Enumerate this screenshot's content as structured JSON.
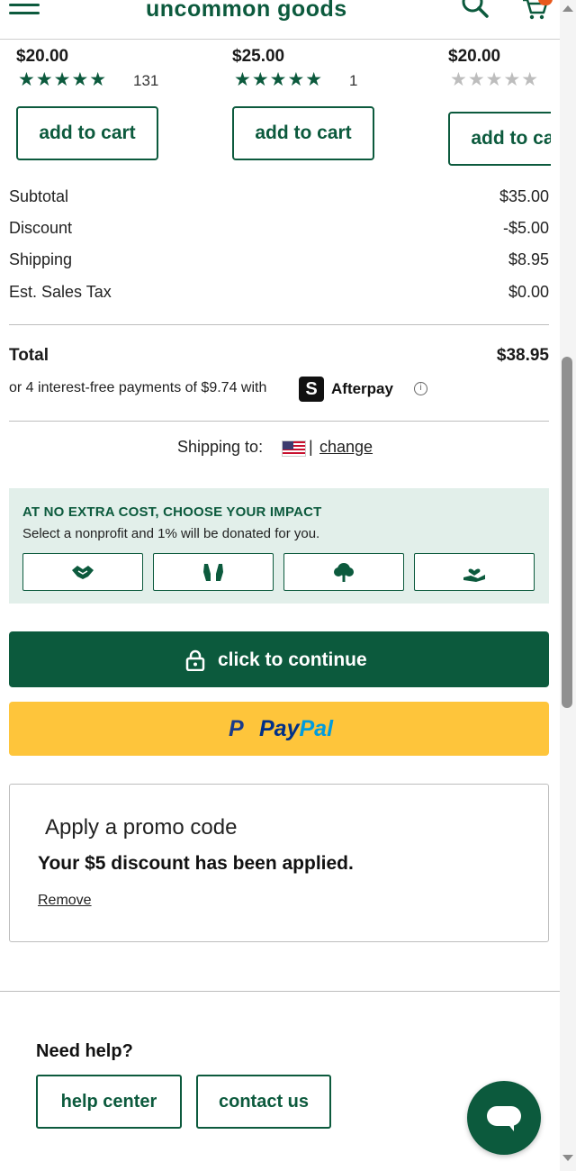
{
  "header": {
    "logo_text": "uncommon goods",
    "menu_icon": "hamburger-menu-icon",
    "search_icon": "search-icon",
    "cart_icon": "cart-icon"
  },
  "products": [
    {
      "price": "$20.00",
      "rating": 5,
      "review_count": "131",
      "button_label": "add to cart"
    },
    {
      "price": "$25.00",
      "rating": 5,
      "review_count": "1",
      "button_label": "add to cart"
    },
    {
      "price": "$20.00",
      "rating": 0,
      "review_count": "",
      "button_label": "add to cart"
    }
  ],
  "summary": {
    "subtotal_label": "Subtotal",
    "subtotal_value": "$35.00",
    "discount_label": "Discount",
    "discount_value": "-$5.00",
    "shipping_label": "Shipping",
    "shipping_value": "$8.95",
    "tax_label": "Est. Sales Tax",
    "tax_value": "$0.00",
    "total_label": "Total",
    "total_value": "$38.95"
  },
  "afterpay": {
    "text": "or 4 interest-free payments of $9.74 with",
    "logo_glyph": "S",
    "brand": "Afterpay",
    "info_glyph": "i"
  },
  "shipping_to": {
    "label": "Shipping to:",
    "separator": "|",
    "change_label": "change"
  },
  "impact": {
    "title": "AT NO EXTRA COST, CHOOSE YOUR IMPACT",
    "subtitle": "Select a nonprofit and 1% will be donated for you.",
    "options": [
      "handshake-icon",
      "raised-hands-icon",
      "tree-icon",
      "heart-in-hand-icon"
    ]
  },
  "actions": {
    "continue_label": "click to continue",
    "paypal_mark": "P",
    "paypal_pay": "Pay",
    "paypal_pal": "Pal"
  },
  "promo": {
    "title": "Apply a promo code",
    "message": "Your $5 discount has been applied.",
    "remove_label": "Remove"
  },
  "help": {
    "title": "Need help?",
    "help_center_label": "help center",
    "contact_label": "contact us"
  },
  "colors": {
    "brand_green": "#0c5a3d",
    "impact_bg": "#e2efea",
    "paypal_yellow": "#fec53b",
    "badge_orange": "#e8581c"
  }
}
